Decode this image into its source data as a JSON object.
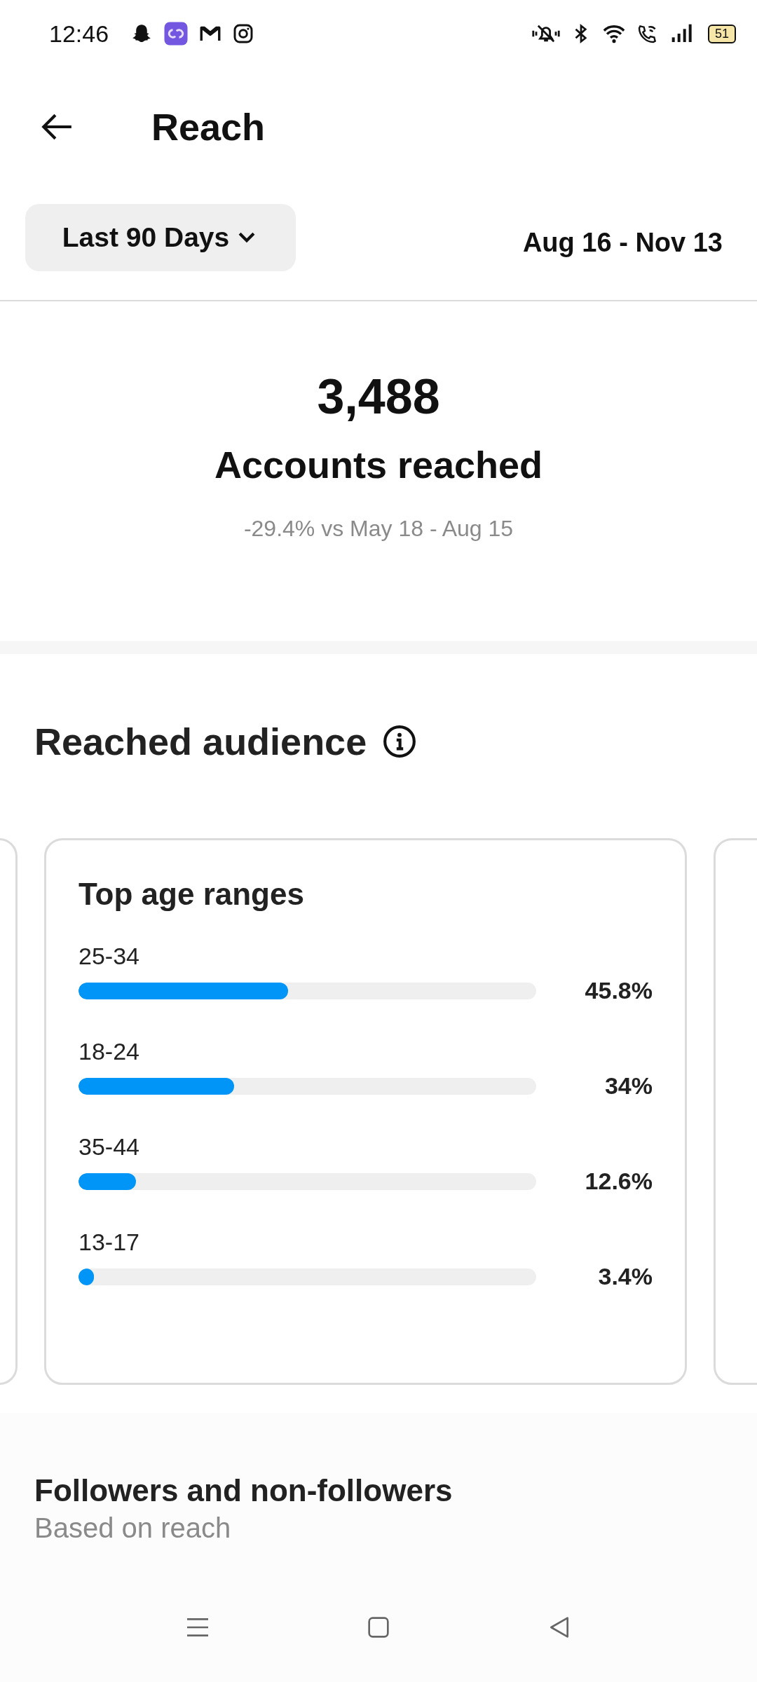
{
  "status_bar": {
    "time": "12:46",
    "battery": "51"
  },
  "header": {
    "title": "Reach"
  },
  "filter": {
    "range": "Last 90 Days",
    "dates": "Aug 16 - Nov 13"
  },
  "summary": {
    "value": "3,488",
    "label": "Accounts reached",
    "comparison": "-29.4% vs May 18 - Aug 15"
  },
  "audience": {
    "title": "Reached audience",
    "card": {
      "title": "Top age ranges",
      "rows": [
        {
          "label": "25-34",
          "level": 0.458,
          "value": "45.8%"
        },
        {
          "label": "18-24",
          "level": 0.34,
          "value": "34%"
        },
        {
          "label": "35-44",
          "level": 0.126,
          "value": "12.6%"
        },
        {
          "label": "13-17",
          "level": 0.034,
          "value": "3.4%"
        }
      ]
    }
  },
  "followers": {
    "title": "Followers and non-followers",
    "subtitle": "Based on reach"
  }
}
